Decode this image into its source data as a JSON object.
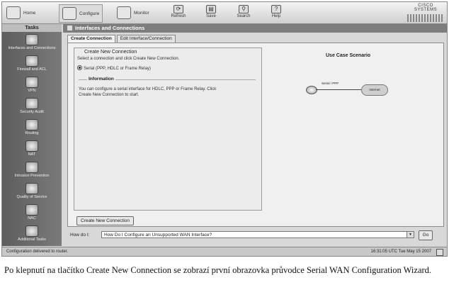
{
  "toolbar": {
    "home": "Home",
    "configure": "Configure",
    "monitor": "Monitor",
    "refresh": "Refresh",
    "save": "Save",
    "search": "Search",
    "help": "Help",
    "brand": "CISCO SYSTEMS"
  },
  "sidebar": {
    "header": "Tasks",
    "items": [
      {
        "label": "Interfaces and Connections",
        "icon": "interfaces-icon"
      },
      {
        "label": "Firewall and ACL",
        "icon": "firewall-icon"
      },
      {
        "label": "VPN",
        "icon": "vpn-icon"
      },
      {
        "label": "Security Audit",
        "icon": "security-audit-icon"
      },
      {
        "label": "Routing",
        "icon": "routing-icon"
      },
      {
        "label": "NAT",
        "icon": "nat-icon"
      },
      {
        "label": "Intrusion Prevention",
        "icon": "intrusion-icon"
      },
      {
        "label": "Quality of Service",
        "icon": "qos-icon"
      },
      {
        "label": "NAC",
        "icon": "nac-icon"
      },
      {
        "label": "Additional Tasks",
        "icon": "additional-tasks-icon"
      }
    ]
  },
  "main": {
    "title": "Interfaces and Connections",
    "tabs": [
      "Create Connection",
      "Edit Interface/Connection"
    ],
    "create_group": "Create New Connection",
    "select_prompt": "Select a connection and click Create New Connection.",
    "option_serial": "Serial (PPP, HDLC or Frame Relay)",
    "info_heading": "Information",
    "info_text_1": "You can configure a serial interface for HDLC, PPP or Frame Relay. Click",
    "info_text_2": "Create New Connection to start.",
    "use_case": "Use Case Scenario",
    "diagram_link": "Serial / PPP",
    "diagram_cloud": "Internet",
    "create_button": "Create New Connection"
  },
  "howdo": {
    "label": "How do I:",
    "value": "How Do I Configure an Unsupported WAN Interface?",
    "go": "Go"
  },
  "status": {
    "left": "Configuration delivered to router.",
    "right": "16:31:05 UTC Tue May 15 2007"
  },
  "caption": "Po klepnutí na tlačítko Create New Connection se zobrazí první obrazovka průvodce Serial WAN Configuration Wizard."
}
